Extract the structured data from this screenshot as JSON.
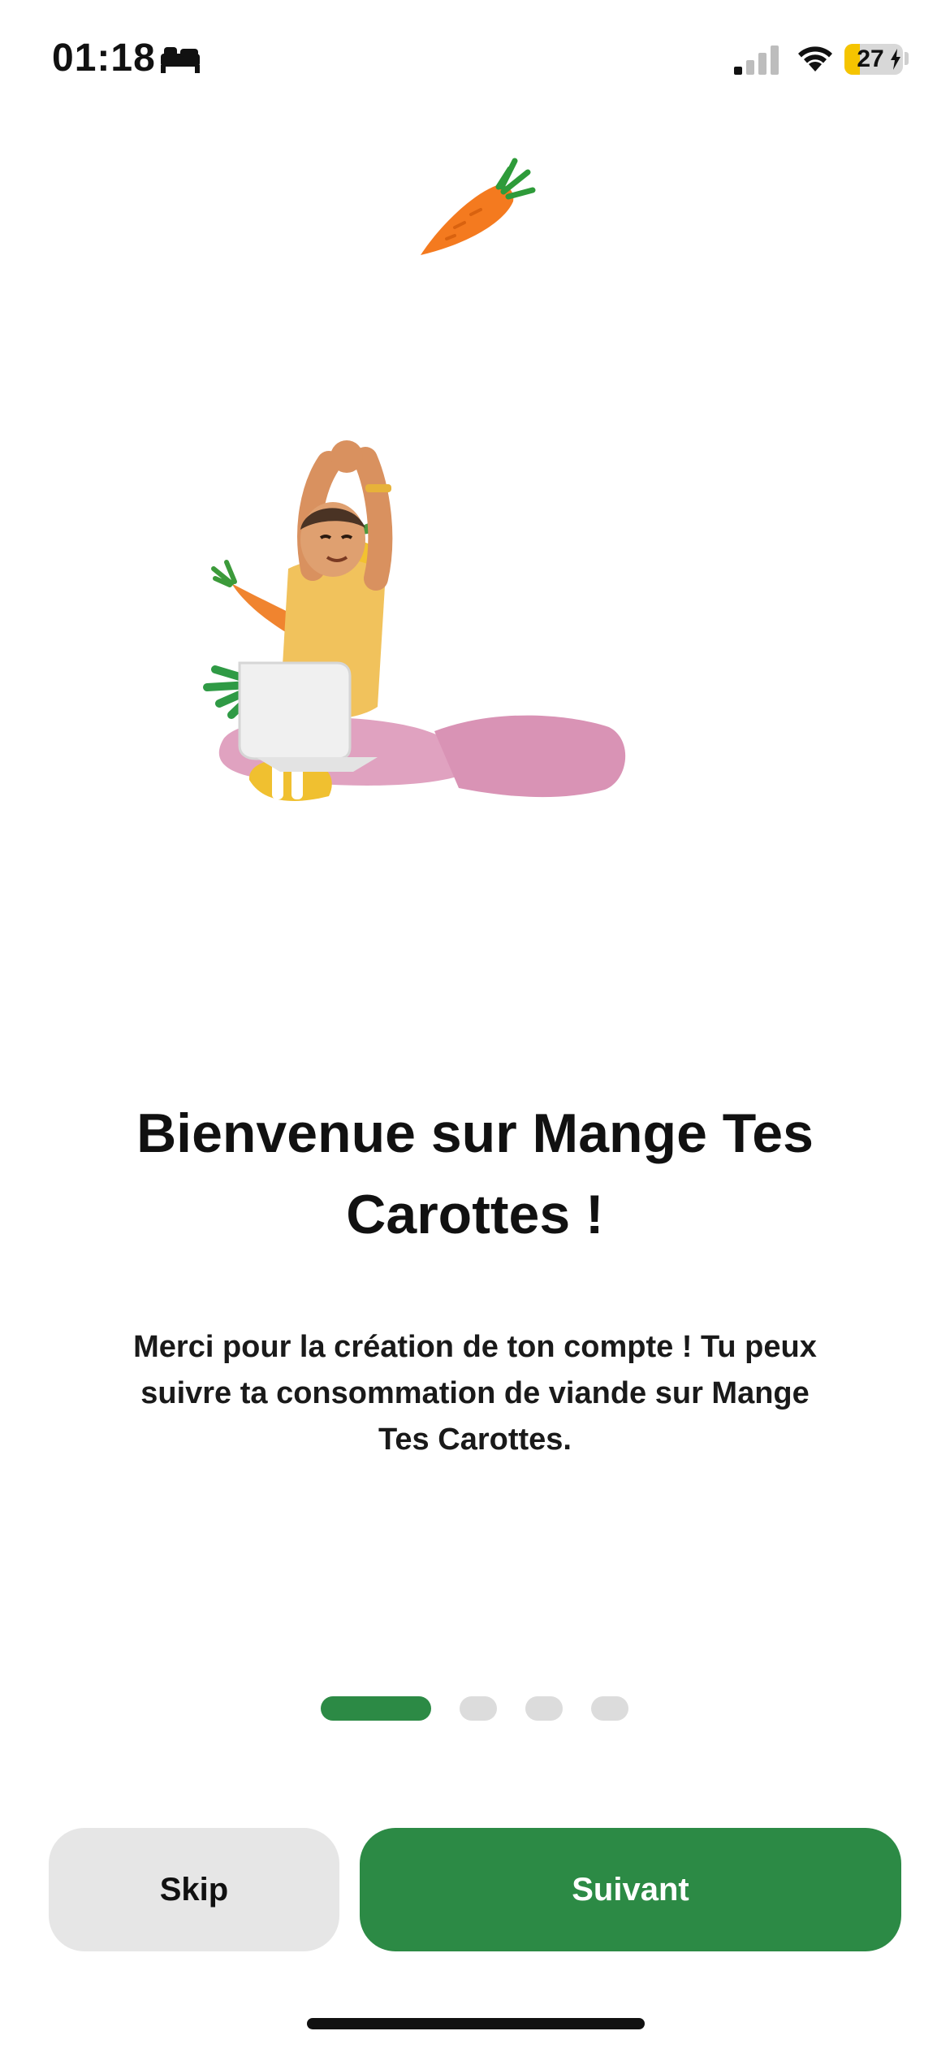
{
  "status_bar": {
    "time": "01:18",
    "battery_level": "27",
    "icons": [
      "bed-icon",
      "cellular-signal-icon",
      "wifi-icon",
      "battery-charging-icon"
    ]
  },
  "logo": {
    "icon": "carrot-icon",
    "color": "#f47a1f"
  },
  "hero": {
    "icon": "person-stretching-with-laptop-and-vegetables-illustration"
  },
  "onboarding": {
    "title": "Bienvenue sur Mange Tes Carottes !",
    "description": "Merci pour la création de ton compte ! Tu peux suivre ta consommation de viande sur Mange Tes Carottes.",
    "page_count": 4,
    "current_page": 1
  },
  "buttons": {
    "skip_label": "Skip",
    "next_label": "Suivant"
  },
  "colors": {
    "accent": "#2c8a45",
    "secondary_button": "#e6e6e6",
    "battery": "#f5c400"
  }
}
